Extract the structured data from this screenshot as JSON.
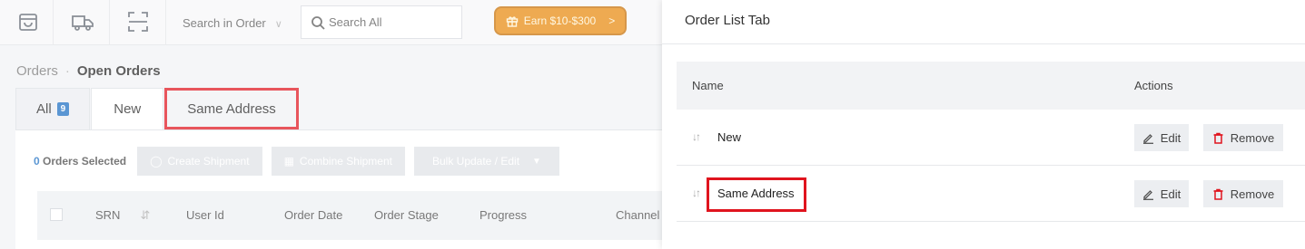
{
  "topbar": {
    "icons": [
      "shop-bag-icon",
      "truck-icon",
      "scan-icon"
    ],
    "search_scope": "Search in Order",
    "search_placeholder": "Search All",
    "earn_label": "Earn $10-$300",
    "earn_chevron": ">"
  },
  "breadcrumb": {
    "root": "Orders",
    "separator": "·",
    "current": "Open Orders"
  },
  "tabs": [
    {
      "label": "All",
      "count": "9"
    },
    {
      "label": "New"
    },
    {
      "label": "Same Address"
    }
  ],
  "toolbar": {
    "selected_count": "0",
    "selected_suffix": "Orders Selected",
    "create_shipment": "Create Shipment",
    "combine_shipment": "Combine Shipment",
    "bulk_update": "Bulk Update / Edit"
  },
  "table_headers": [
    "SRN",
    "User Id",
    "Order Date",
    "Order Stage",
    "Progress",
    "Channel"
  ],
  "drawer": {
    "title": "Order List Tab",
    "col_name": "Name",
    "col_actions": "Actions",
    "rows": [
      {
        "name": "New",
        "edit": "Edit",
        "remove": "Remove"
      },
      {
        "name": "Same Address",
        "edit": "Edit",
        "remove": "Remove"
      }
    ]
  },
  "colors": {
    "accent": "#1b6ec2",
    "earn": "#e8890f",
    "highlight": "#e0141e",
    "remove_icon": "#e0141e"
  }
}
